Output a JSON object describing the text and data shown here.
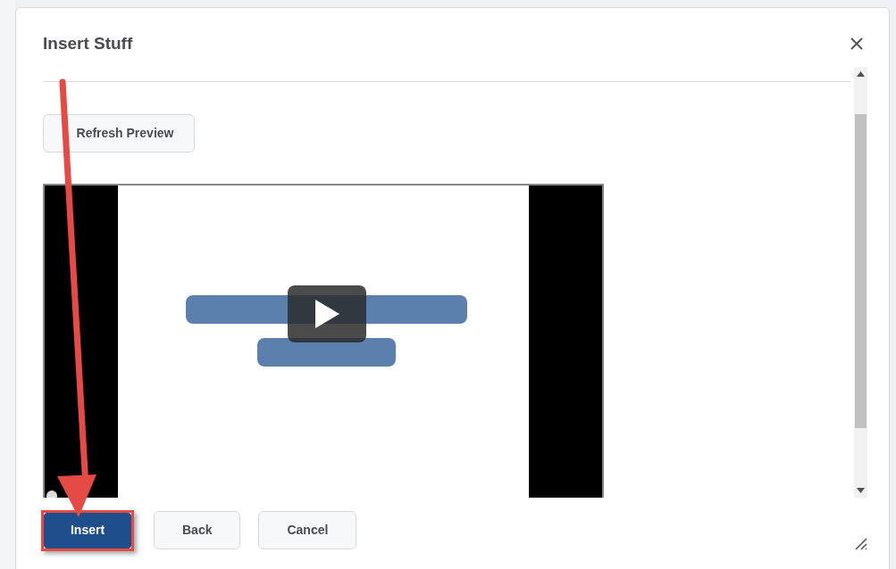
{
  "dialog": {
    "title": "Insert Stuff"
  },
  "preview": {
    "refresh_button": "Refresh Preview"
  },
  "buttons": [
    {
      "label": "Insert",
      "kind": "primary"
    },
    {
      "label": "Back",
      "kind": "secondary"
    },
    {
      "label": "Cancel",
      "kind": "secondary"
    }
  ]
}
